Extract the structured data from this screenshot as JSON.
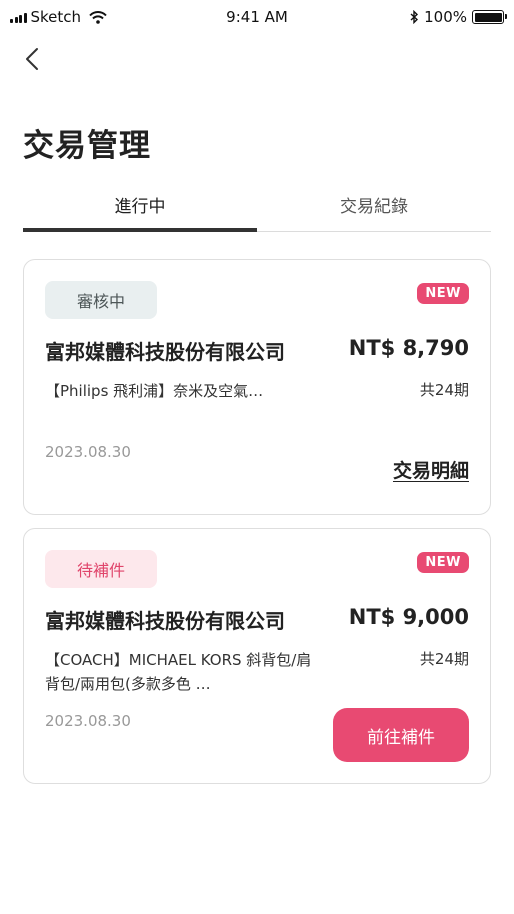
{
  "status_bar": {
    "carrier": "Sketch",
    "time": "9:41 AM",
    "battery_text": "100%"
  },
  "header": {
    "title": "交易管理"
  },
  "tabs": [
    {
      "label": "進行中",
      "active": true
    },
    {
      "label": "交易紀錄",
      "active": false
    }
  ],
  "transactions": [
    {
      "status": "審核中",
      "new_label": "NEW",
      "company": "富邦媒體科技股份有限公司",
      "amount": "NT$ 8,790",
      "product": "【Philips 飛利浦】奈米及空氣…",
      "installments": "共24期",
      "date": "2023.08.30",
      "action_label": "交易明細"
    },
    {
      "status": "待補件",
      "new_label": "NEW",
      "company": "富邦媒體科技股份有限公司",
      "amount": "NT$ 9,000",
      "product": "【COACH】MICHAEL KORS 斜背包/肩背包/兩用包(多款多色 …",
      "installments": "共24期",
      "date": "2023.08.30",
      "action_label": "前往補件"
    }
  ],
  "colors": {
    "accent": "#e84a72",
    "review_badge_bg": "#e9eff0",
    "pending_badge_bg": "#fde8ec"
  },
  "icons": {
    "signal": "signal-icon",
    "wifi": "wifi-icon",
    "bluetooth": "bluetooth-icon",
    "battery": "battery-icon",
    "back": "chevron-left-icon"
  }
}
